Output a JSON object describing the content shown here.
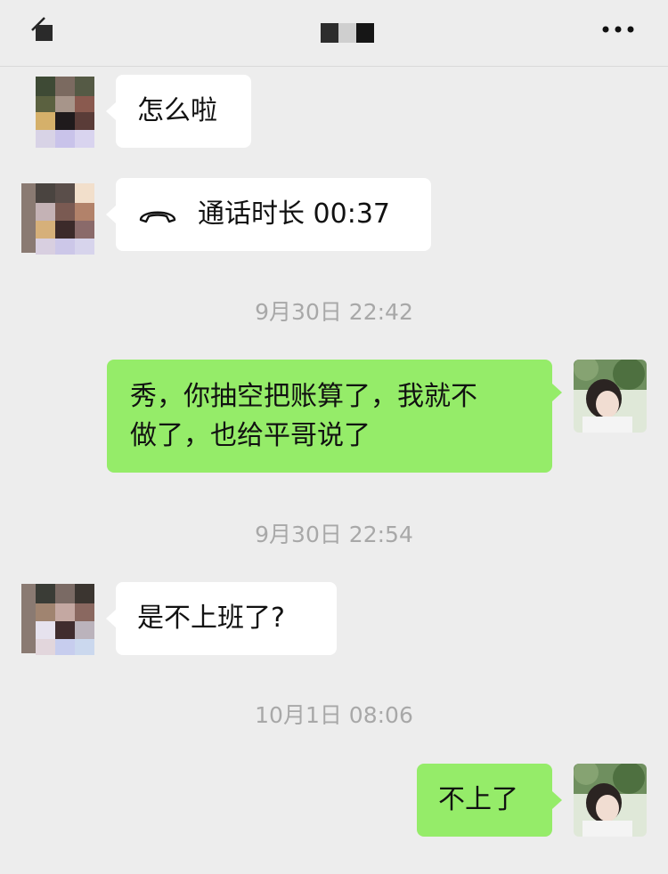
{
  "header": {
    "back_icon": "back-arrow-icon",
    "title_obscured": true,
    "more_icon": "more-dots-icon",
    "more_label": "•••"
  },
  "messages": [
    {
      "sender": "contact",
      "type": "text",
      "text": "怎么啦"
    },
    {
      "sender": "contact",
      "type": "call",
      "icon": "phone-hangup-icon",
      "text": "通话时长 00:37"
    },
    {
      "type": "timestamp",
      "text": "9月30日 22:42"
    },
    {
      "sender": "me",
      "type": "text",
      "lines": [
        "秀，你抽空把账算了，我就不",
        "做了，也给平哥说了"
      ]
    },
    {
      "type": "timestamp",
      "text": "9月30日 22:54"
    },
    {
      "sender": "contact",
      "type": "text",
      "text": "是不上班了?"
    },
    {
      "type": "timestamp",
      "text": "10月1日 08:06"
    },
    {
      "sender": "me",
      "type": "text",
      "text": "不上了"
    }
  ],
  "colors": {
    "background": "#ededed",
    "incoming_bubble": "#ffffff",
    "outgoing_bubble": "#95ec69",
    "timestamp_text": "#a8a8a8"
  }
}
